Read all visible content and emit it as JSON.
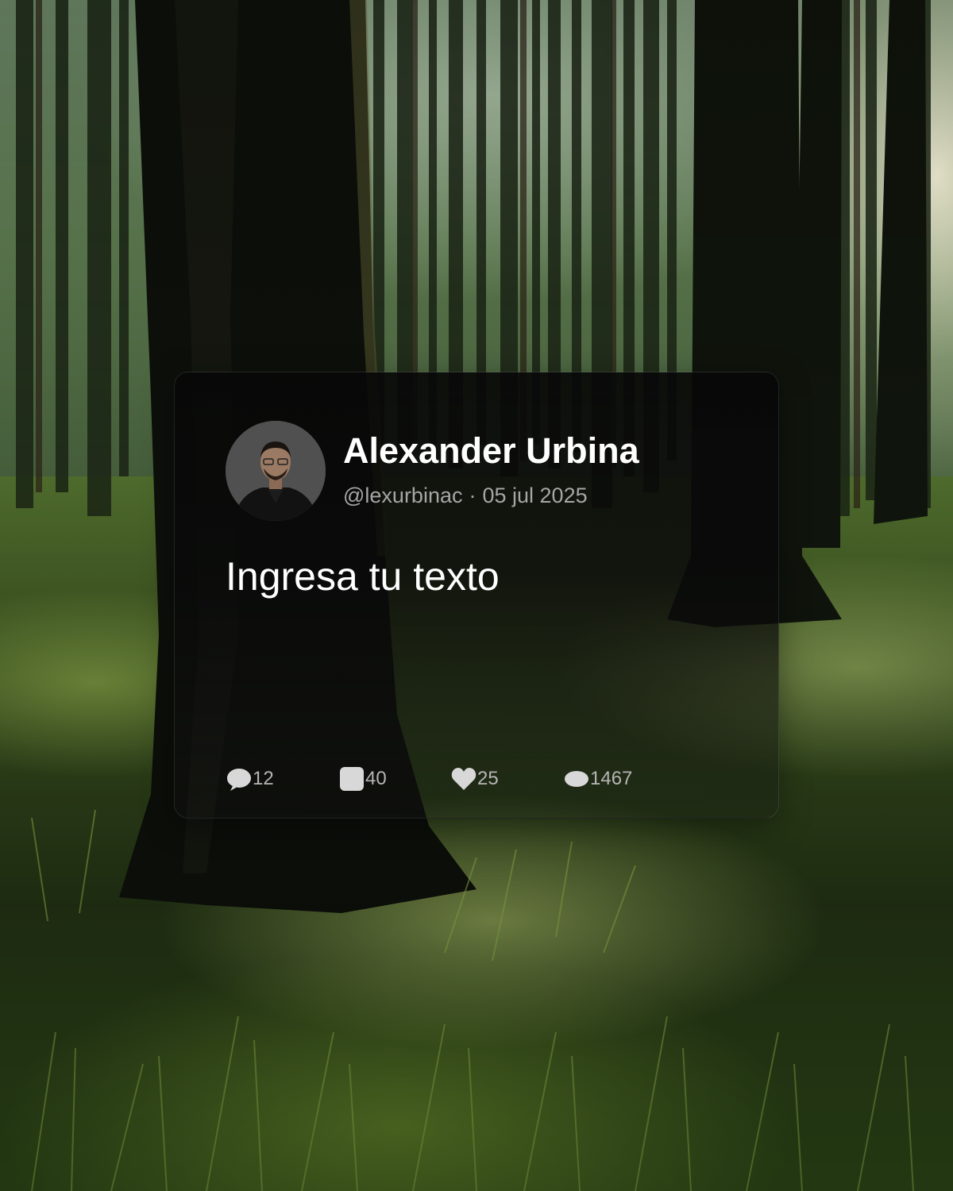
{
  "post": {
    "author_name": "Alexander Urbina",
    "handle": "@lexurbinac",
    "separator": "·",
    "date": "05 jul 2025",
    "text": "Ingresa tu texto"
  },
  "stats": {
    "replies": "12",
    "reposts": "40",
    "likes": "25",
    "views": "1467"
  },
  "icons": {
    "replies": "comment-icon",
    "reposts": "repost-icon",
    "likes": "heart-icon",
    "views": "eye-icon"
  },
  "colors": {
    "card_bg": "#0a0a0a",
    "name": "#ffffff",
    "meta": "#a6a6a6",
    "stat": "#b5b5b5"
  }
}
